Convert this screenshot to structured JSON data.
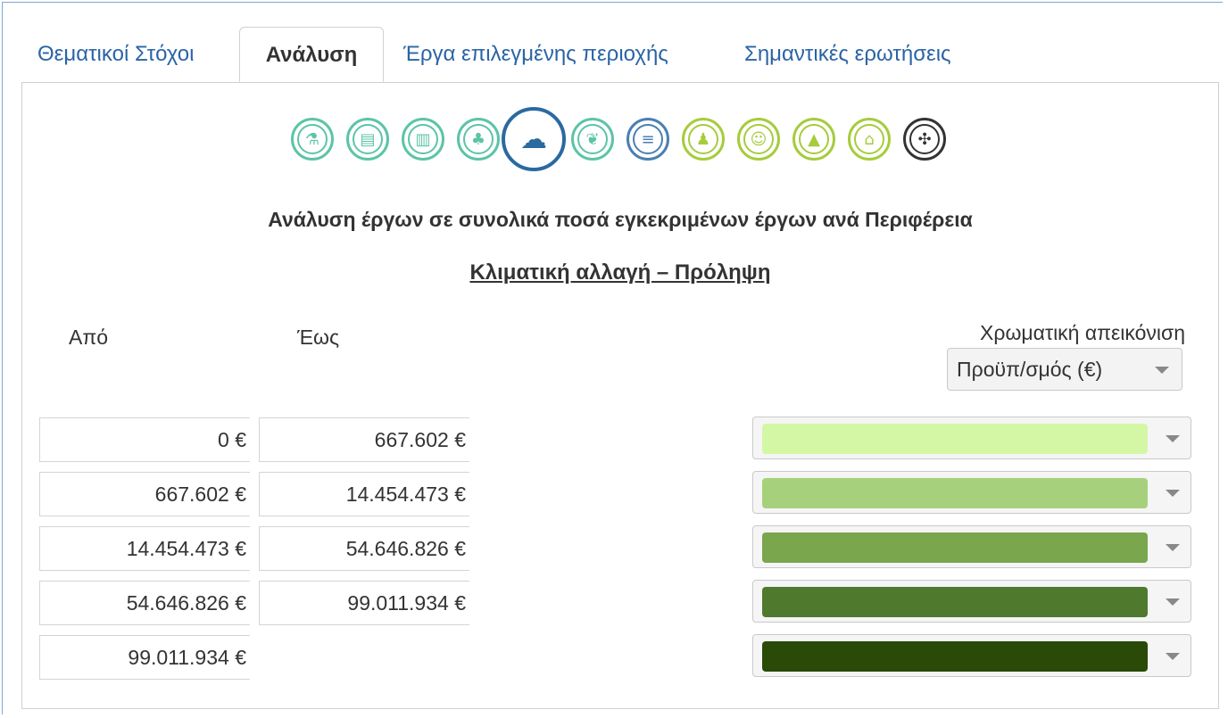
{
  "tabs": [
    {
      "label": "Θεματικοί Στόχοι"
    },
    {
      "label": "Ανάλυση"
    },
    {
      "label": "Έργα επιλεγμένης περιοχής"
    },
    {
      "label": "Σημαντικές ερωτήσεις"
    }
  ],
  "active_tab": "Ανάλυση",
  "theme_icons": [
    {
      "name": "research-icon",
      "color": "#5cc4a7",
      "glyph": "⚗"
    },
    {
      "name": "digital-document-icon",
      "color": "#5cc4a7",
      "glyph": "▤"
    },
    {
      "name": "business-icon",
      "color": "#5cc4a7",
      "glyph": "▥"
    },
    {
      "name": "low-carbon-tree-icon",
      "color": "#5cc4a7",
      "glyph": "♣"
    },
    {
      "name": "climate-weather-icon",
      "color": "#2a6aa0",
      "glyph": "☁",
      "selected": true
    },
    {
      "name": "environment-plant-icon",
      "color": "#5cc4a7",
      "glyph": "❦"
    },
    {
      "name": "transport-rail-icon",
      "color": "#4a7fb3",
      "glyph": "≡"
    },
    {
      "name": "employment-person-icon",
      "color": "#a6cc3c",
      "glyph": "♟"
    },
    {
      "name": "social-inclusion-icon",
      "color": "#a6cc3c",
      "glyph": "☺"
    },
    {
      "name": "education-cap-icon",
      "color": "#a6cc3c",
      "glyph": "▲"
    },
    {
      "name": "institutions-building-icon",
      "color": "#a6cc3c",
      "glyph": "⌂"
    },
    {
      "name": "other-directions-icon",
      "color": "#333333",
      "glyph": "✣"
    }
  ],
  "heading": "Ανάλυση έργων σε συνολικά ποσά εγκεκριμένων έργων ανά Περιφέρεια",
  "subheading": "Κλιματική αλλαγή – Πρόληψη",
  "labels": {
    "from": "Από",
    "to": "Έως",
    "color_display": "Χρωματική απεικόνιση"
  },
  "color_select": {
    "value": "Προϋπ/σμός (€)"
  },
  "ranges": [
    {
      "from": "0 €",
      "to": "667.602 €",
      "color": "#d4f7a6"
    },
    {
      "from": "667.602 €",
      "to": "14.454.473 €",
      "color": "#a7d07c"
    },
    {
      "from": "14.454.473 €",
      "to": "54.646.826 €",
      "color": "#7aa64e"
    },
    {
      "from": "54.646.826 €",
      "to": "99.011.934 €",
      "color": "#4f7a2e"
    },
    {
      "from": "99.011.934 €",
      "to": "",
      "color": "#2a4a08"
    }
  ]
}
